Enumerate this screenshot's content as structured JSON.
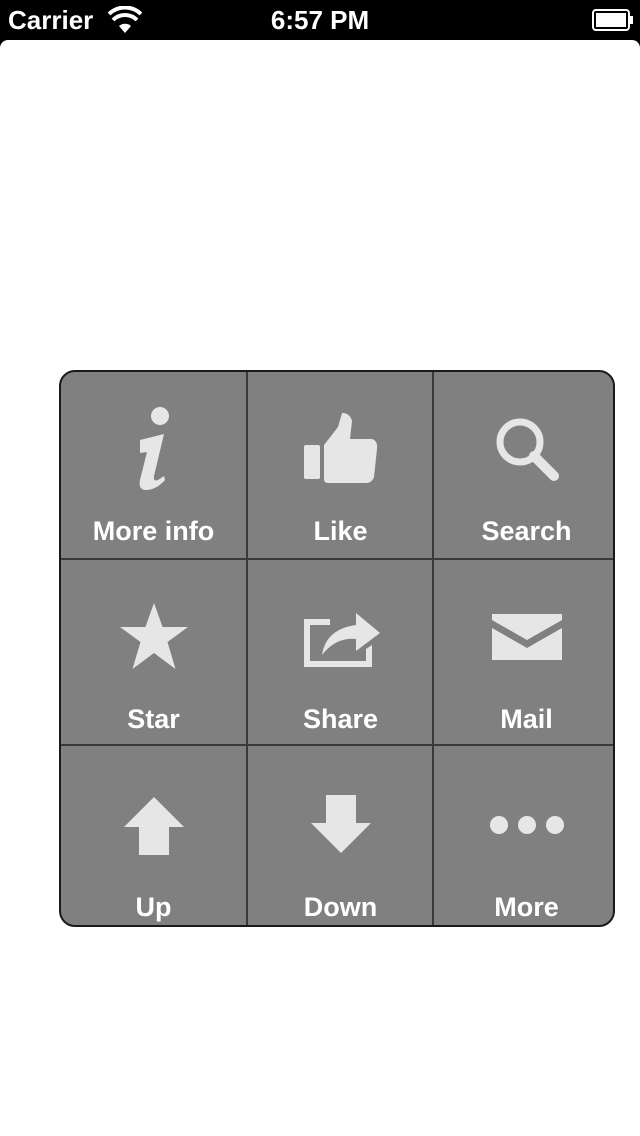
{
  "status_bar": {
    "carrier": "Carrier",
    "time": "6:57 PM",
    "wifi_icon": "wifi-icon",
    "battery_icon": "battery-icon"
  },
  "menu": {
    "background_color": "#808080",
    "icon_color": "#e6e6e6",
    "items": [
      {
        "label": "More info",
        "icon": "info-icon"
      },
      {
        "label": "Like",
        "icon": "thumbs-up-icon"
      },
      {
        "label": "Search",
        "icon": "search-icon"
      },
      {
        "label": "Star",
        "icon": "star-icon"
      },
      {
        "label": "Share",
        "icon": "share-icon"
      },
      {
        "label": "Mail",
        "icon": "mail-icon"
      },
      {
        "label": "Up",
        "icon": "arrow-up-icon"
      },
      {
        "label": "Down",
        "icon": "arrow-down-icon"
      },
      {
        "label": "More",
        "icon": "more-icon"
      }
    ]
  }
}
